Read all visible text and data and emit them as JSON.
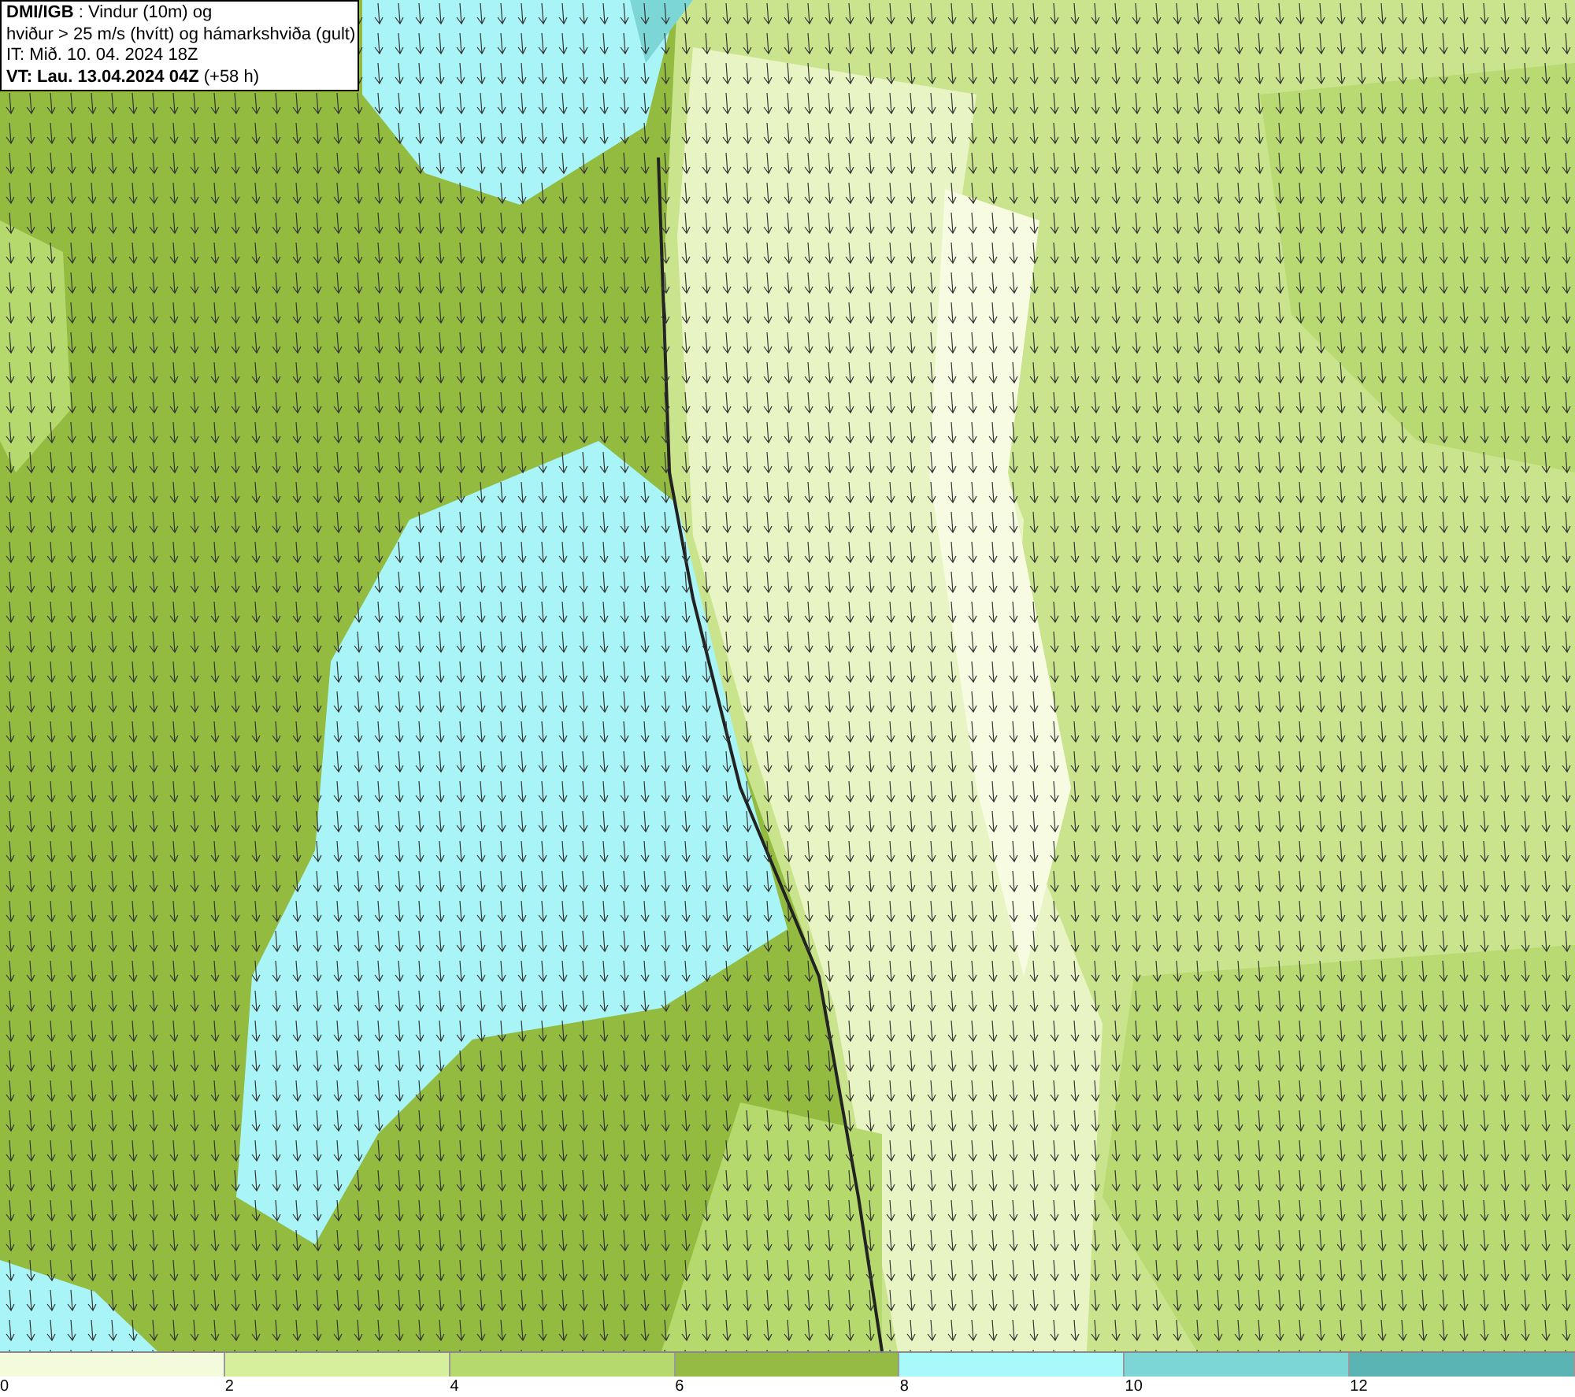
{
  "header": {
    "lines": [
      "**DMI/IGB** : Vindur (10m) og",
      "hviður > 25 m/s (hvítt) og hámarkshviða (gult)",
      "IT: Mið. 10. 04. 2024 18Z",
      "**VT: Lau. 13.04.2024 04Z** (+58 h)"
    ]
  },
  "legend": {
    "bins": [
      {
        "label": "0",
        "color": "#f4fadc"
      },
      {
        "label": "2",
        "color": "#d6ef9c"
      },
      {
        "label": "4",
        "color": "#b5d96c"
      },
      {
        "label": "6",
        "color": "#96bb44"
      },
      {
        "label": "8",
        "color": "#a8fafa"
      },
      {
        "label": "10",
        "color": "#7dd6d6"
      },
      {
        "label": "12",
        "color": "#5ab4b4"
      }
    ]
  }
}
